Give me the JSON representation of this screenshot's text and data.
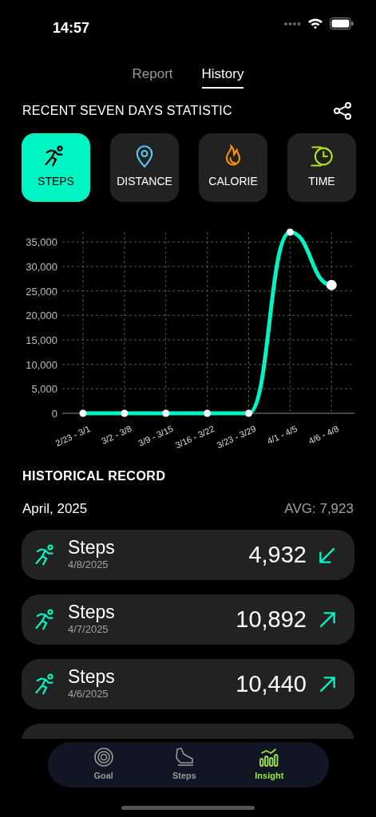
{
  "status_bar": {
    "time": "14:57"
  },
  "tabs": [
    {
      "label": "Report",
      "selected": false
    },
    {
      "label": "History",
      "selected": true
    }
  ],
  "section_title": "RECENT SEVEN DAYS STATISTIC",
  "metrics": [
    {
      "kind": "steps",
      "label": "STEPS",
      "selected": true,
      "color": "#00f5c4"
    },
    {
      "kind": "distance",
      "label": "DISTANCE",
      "selected": false,
      "color": "#5ac8fa"
    },
    {
      "kind": "calorie",
      "label": "CALORIE",
      "selected": false,
      "color": "#ff9500"
    },
    {
      "kind": "time",
      "label": "TIME",
      "selected": false,
      "color": "#b4e61e"
    }
  ],
  "chart": {
    "chart_data": {
      "type": "line",
      "categories": [
        "2/23 - 3/1",
        "3/2 - 3/8",
        "3/9 - 3/15",
        "3/16 - 3/22",
        "3/23 - 3/29",
        "4/1 - 4/5",
        "4/6 - 4/8"
      ],
      "series": [
        {
          "color": "#00f5c4",
          "marker": "circle",
          "values": [
            0,
            0,
            0,
            0,
            0,
            37000,
            26200
          ]
        }
      ],
      "grid": true,
      "ylim": [
        0,
        37000
      ],
      "yticks": [
        {
          "value": 0,
          "label": "0"
        },
        {
          "value": 5000,
          "label": "5,000"
        },
        {
          "value": 10000,
          "label": "10,000"
        },
        {
          "value": 15000,
          "label": "15,000"
        },
        {
          "value": 20000,
          "label": "20,000"
        },
        {
          "value": 25000,
          "label": "25,000"
        },
        {
          "value": 30000,
          "label": "30,000"
        },
        {
          "value": 35000,
          "label": "35,000"
        }
      ]
    }
  },
  "history": {
    "title": "HISTORICAL RECORD",
    "month": "April, 2025",
    "average": "AVG: 7,923",
    "records": [
      {
        "title": "Steps",
        "date": "4/8/2025",
        "value": "4,932",
        "kind": "down"
      },
      {
        "title": "Steps",
        "date": "4/7/2025",
        "value": "10,892",
        "kind": "up"
      },
      {
        "title": "Steps",
        "date": "4/6/2025",
        "value": "10,440",
        "kind": "up"
      }
    ]
  },
  "nav": [
    {
      "kind": "goal",
      "label": "Goal",
      "selected": false
    },
    {
      "kind": "steps",
      "label": "Steps",
      "selected": false
    },
    {
      "kind": "insight",
      "label": "Insight",
      "selected": true
    }
  ]
}
